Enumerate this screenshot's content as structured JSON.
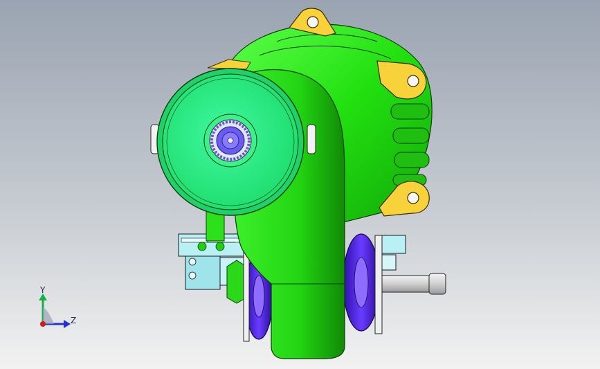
{
  "viewport": {
    "background_top": "#9aa3b1",
    "background_bottom": "#f2f2f2"
  },
  "model": {
    "body_color": "#22e010",
    "front_disc_color": "#2ef27c",
    "mount_lug_color": "#f7d23a",
    "bearing_color": "#4a22d6",
    "bracket_color": "#b8f0f5",
    "shaft_color": "#d8d8d8"
  },
  "triad": {
    "y_label": "Y",
    "z_label": "Z",
    "y_color": "#16b04a",
    "z_color": "#2233cc",
    "x_color": "#d21a1a"
  }
}
